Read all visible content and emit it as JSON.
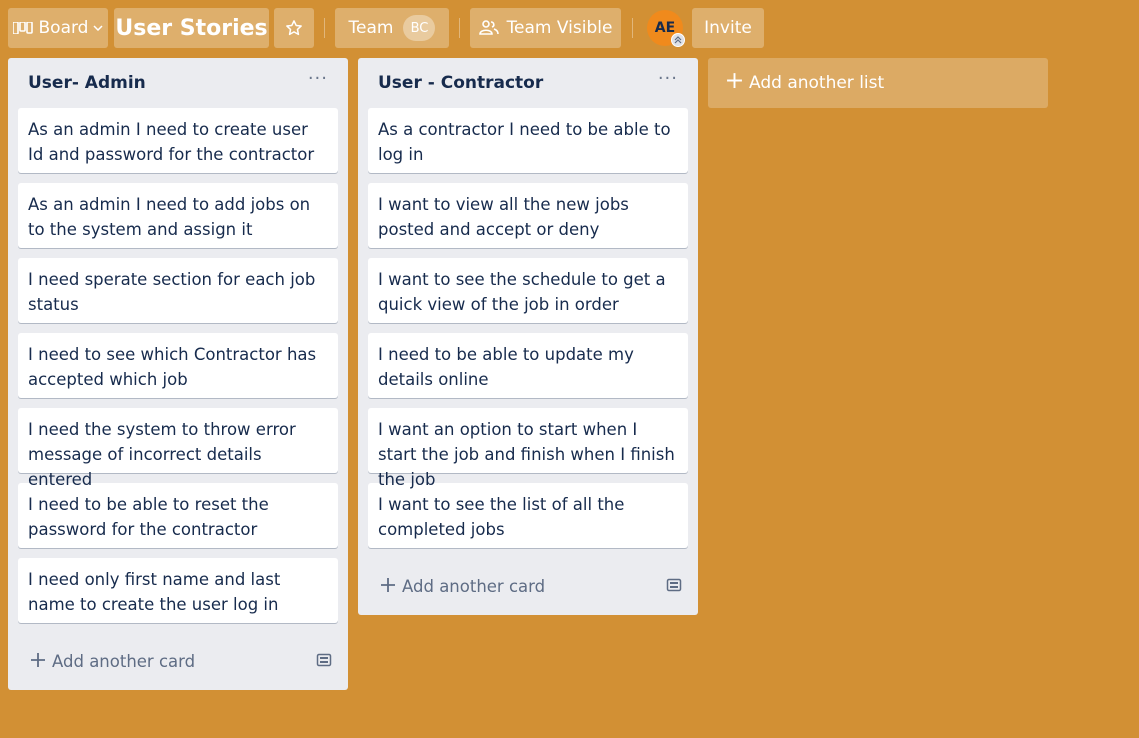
{
  "header": {
    "board_switcher_label": "Board",
    "board_title": "User Stories",
    "team_label": "Team",
    "team_avatar": "BC",
    "visibility_label": "Team Visible",
    "member_avatar": "AE",
    "invite_label": "Invite"
  },
  "colors": {
    "background": "#d29034",
    "list_bg": "#ebecf0",
    "card_bg": "#ffffff",
    "text": "#172b4d",
    "muted": "#5e6c84",
    "avatar": "#f08a1c"
  },
  "icons": {
    "board": "board-icon",
    "chevron": "chevron-down-icon",
    "star": "star-icon",
    "visibility": "team-visible-icon",
    "list_menu": "more-icon",
    "add": "plus-icon",
    "template": "card-template-icon"
  },
  "lists": [
    {
      "title": "User- Admin",
      "cards": [
        {
          "text": "As an admin I need to create user Id and password for the contractor"
        },
        {
          "text": "As an admin I need to add jobs on to the system and assign it"
        },
        {
          "text": "I need sperate section for each job status"
        },
        {
          "text": "I need to see which Contractor has accepted which job"
        },
        {
          "text": "I need the system to throw error message of incorrect details entered"
        },
        {
          "text": "I need to be able to reset the password for the contractor"
        },
        {
          "text": "I need only first name and last name to create the user log in"
        }
      ],
      "add_card_label": "Add another card"
    },
    {
      "title": "User - Contractor",
      "cards": [
        {
          "text": "As a contractor I need to be able to log in"
        },
        {
          "text": "I want to view all the new jobs posted and accept or deny"
        },
        {
          "text": "I want to see the schedule to get a quick view of the job in order"
        },
        {
          "text": "I need to be able to update my details online"
        },
        {
          "text": "I want an option to start when I start the job and finish when I finish the job"
        },
        {
          "text": "I want to see the list of all the completed jobs"
        }
      ],
      "add_card_label": "Add another card"
    }
  ],
  "add_list_label": "Add another list"
}
